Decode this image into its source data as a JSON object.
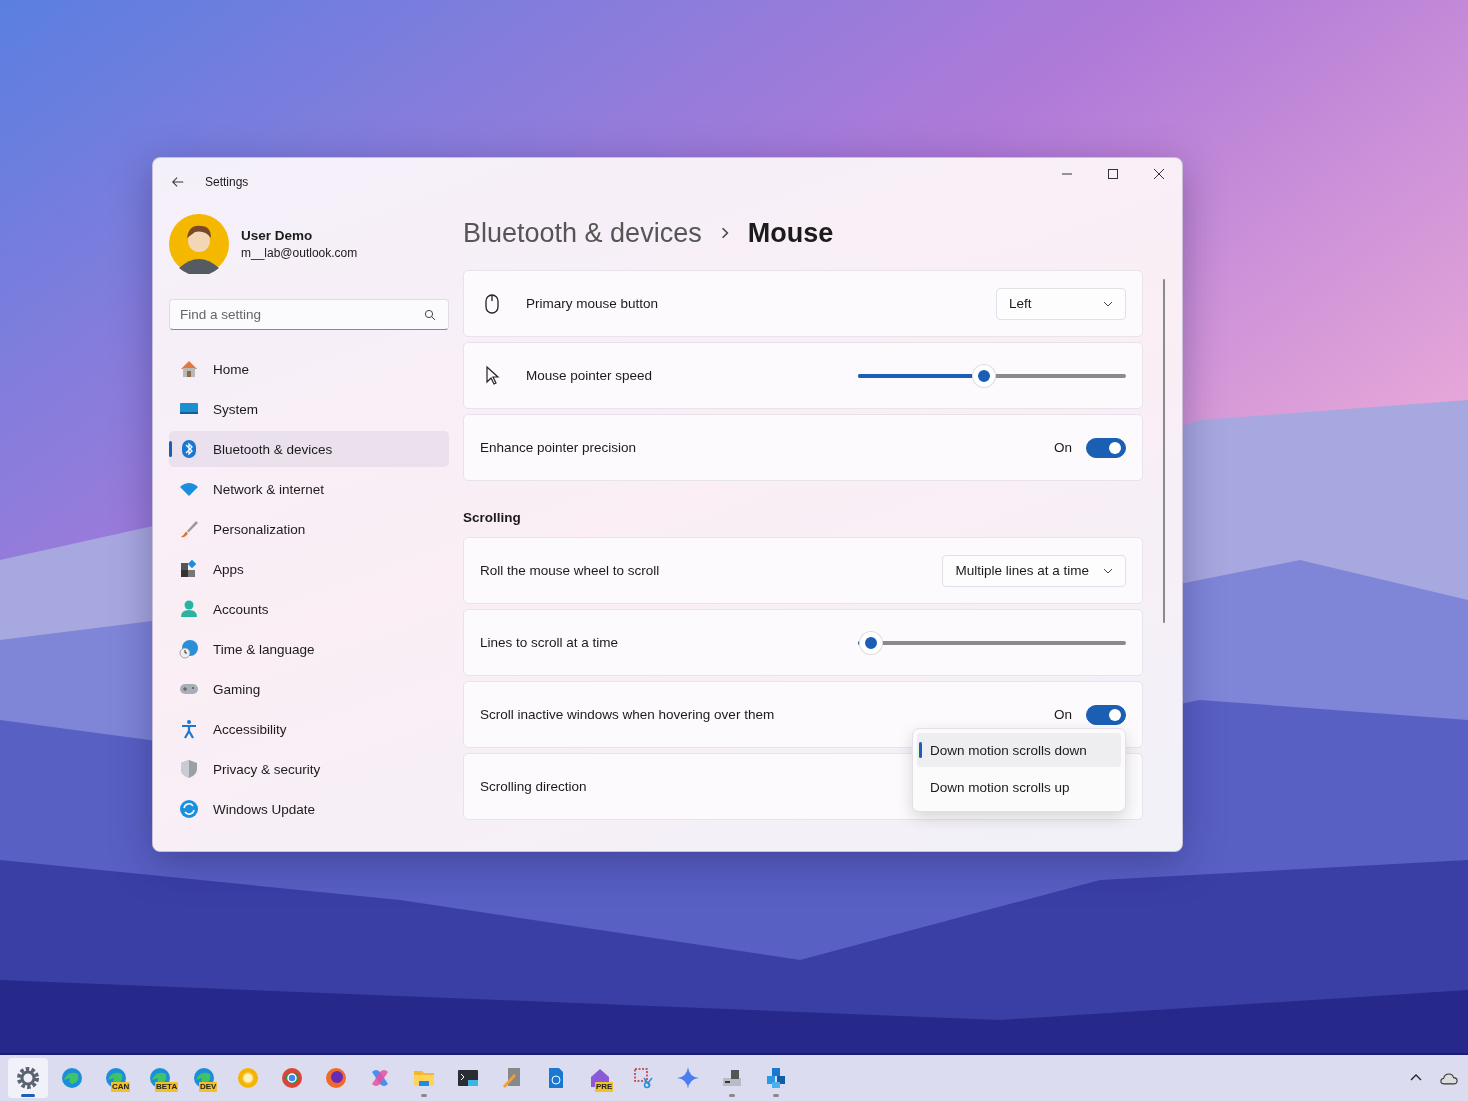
{
  "window": {
    "title": "Settings"
  },
  "profile": {
    "name": "User Demo",
    "email": "m__lab@outlook.com"
  },
  "search": {
    "placeholder": "Find a setting"
  },
  "nav": [
    {
      "label": "Home",
      "selected": false
    },
    {
      "label": "System",
      "selected": false
    },
    {
      "label": "Bluetooth & devices",
      "selected": true
    },
    {
      "label": "Network & internet",
      "selected": false
    },
    {
      "label": "Personalization",
      "selected": false
    },
    {
      "label": "Apps",
      "selected": false
    },
    {
      "label": "Accounts",
      "selected": false
    },
    {
      "label": "Time & language",
      "selected": false
    },
    {
      "label": "Gaming",
      "selected": false
    },
    {
      "label": "Accessibility",
      "selected": false
    },
    {
      "label": "Privacy & security",
      "selected": false
    },
    {
      "label": "Windows Update",
      "selected": false
    }
  ],
  "breadcrumb": {
    "parent": "Bluetooth & devices",
    "current": "Mouse"
  },
  "sections": [
    {
      "rows": [
        {
          "kind": "dropdown",
          "label": "Primary mouse button",
          "value": "Left"
        },
        {
          "kind": "slider",
          "label": "Mouse pointer speed",
          "level": 0.47
        },
        {
          "kind": "toggle",
          "label": "Enhance pointer precision",
          "state_text": "On",
          "on": true
        }
      ]
    },
    {
      "title": "Scrolling",
      "rows": [
        {
          "kind": "dropdown",
          "label": "Roll the mouse wheel to scroll",
          "value": "Multiple lines at a time"
        },
        {
          "kind": "slider",
          "label": "Lines to scroll at a time",
          "level": 0.05
        },
        {
          "kind": "toggle",
          "label": "Scroll inactive windows when hovering over them",
          "state_text": "On",
          "on": true
        },
        {
          "kind": "dropdown",
          "label": "Scrolling direction",
          "expanded": true,
          "options": [
            {
              "label": "Down motion scrolls down",
              "selected": true
            },
            {
              "label": "Down motion scrolls up",
              "selected": false
            }
          ]
        }
      ]
    }
  ],
  "taskbar": {
    "apps": [
      {
        "selected": true,
        "running": true
      },
      {
        "selected": false,
        "running": false
      },
      {
        "selected": false,
        "running": false,
        "badge": "CAN"
      },
      {
        "selected": false,
        "running": false,
        "badge": "BETA"
      },
      {
        "selected": false,
        "running": false,
        "badge": "DEV"
      },
      {
        "selected": false,
        "running": false
      },
      {
        "selected": false,
        "running": false
      },
      {
        "selected": false,
        "running": false
      },
      {
        "selected": false,
        "running": false
      },
      {
        "selected": false,
        "running": true
      },
      {
        "selected": false,
        "running": false
      },
      {
        "selected": false,
        "running": false
      },
      {
        "selected": false,
        "running": false
      },
      {
        "selected": false,
        "running": false,
        "badge": "PRE"
      },
      {
        "selected": false,
        "running": false
      },
      {
        "selected": false,
        "running": false
      },
      {
        "selected": false,
        "running": true
      },
      {
        "selected": false,
        "running": true
      }
    ]
  }
}
